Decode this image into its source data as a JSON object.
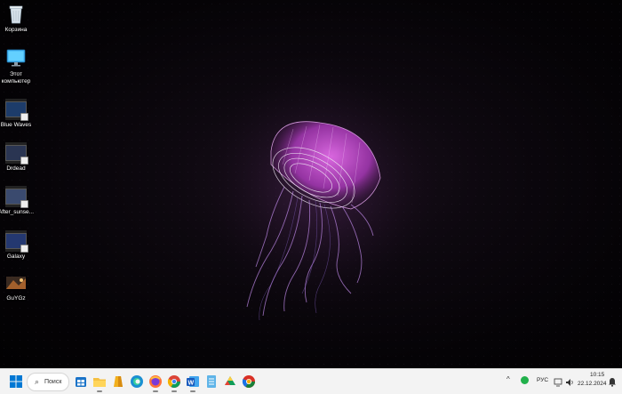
{
  "desktop_icons": [
    {
      "label": "Корзина",
      "icon": "recycle-bin-icon"
    },
    {
      "label": "Этот\nкомпьютер",
      "icon": "this-pc-icon"
    },
    {
      "label": "Blue Waves",
      "icon": "video-file-icon"
    },
    {
      "label": "Drdead",
      "icon": "video-file-icon"
    },
    {
      "label": "After_sunse...",
      "icon": "video-file-icon"
    },
    {
      "label": "Galaxy",
      "icon": "video-file-icon"
    },
    {
      "label": "GuYGz",
      "icon": "image-file-icon"
    }
  ],
  "taskbar": {
    "search_label": "Поиск",
    "apps": [
      "start-icon",
      "search-icon",
      "store-icon",
      "file-explorer-icon",
      "tools-icon",
      "edge-icon",
      "firefox-icon",
      "chrome-icon",
      "word-icon",
      "notepad-icon",
      "drive-icon",
      "chromium-icon"
    ],
    "tray": {
      "language": "РУС",
      "time": "10:15",
      "date": "22.12.2024"
    }
  },
  "colors": {
    "accent": "#0067c0",
    "jellyfish": "#c04ad0",
    "taskbar_bg": "#f3f3f3"
  }
}
